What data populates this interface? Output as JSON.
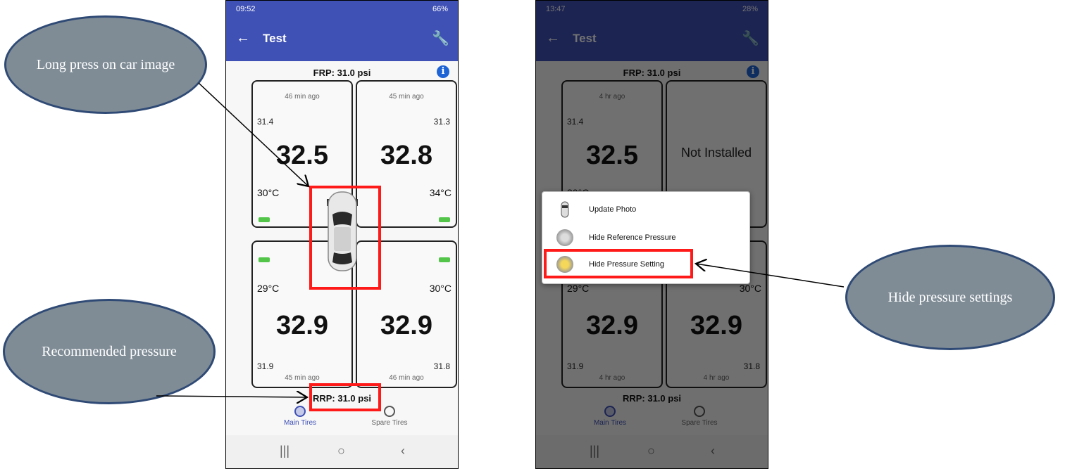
{
  "annotations": {
    "long_press": "Long press on car image",
    "recommended": "Recommended pressure",
    "hide_settings": "Hide pressure settings"
  },
  "phone1": {
    "status_time": "09:52",
    "status_right": "66%",
    "title": "Test",
    "frp": "FRP: 31.0 psi",
    "rrp": "RRP: 31.0 psi",
    "tires": {
      "fl": {
        "ago": "46 min ago",
        "ref": "31.4",
        "pressure": "32.5",
        "temp": "30°C"
      },
      "fr": {
        "ago": "45 min ago",
        "ref": "31.3",
        "pressure": "32.8",
        "temp": "34°C"
      },
      "rl": {
        "ago": "45 min ago",
        "ref": "31.9",
        "pressure": "32.9",
        "temp": "29°C"
      },
      "rr": {
        "ago": "46 min ago",
        "ref": "31.8",
        "pressure": "32.9",
        "temp": "30°C"
      }
    },
    "nav": {
      "main": "Main Tires",
      "spare": "Spare Tires"
    }
  },
  "phone2": {
    "status_time": "13:47",
    "status_right": "28%",
    "title": "Test",
    "frp": "FRP: 31.0 psi",
    "rrp": "RRP: 31.0 psi",
    "tires": {
      "fl": {
        "ago": "4 hr ago",
        "ref": "31.4",
        "pressure": "32.5",
        "temp": "30°C"
      },
      "fr": {
        "not_installed": "Not Installed"
      },
      "rl": {
        "ago": "4 hr ago",
        "ref": "31.9",
        "pressure": "32.9",
        "temp": "29°C"
      },
      "rr": {
        "ago": "4 hr ago",
        "ref": "31.8",
        "pressure": "32.9",
        "temp": "30°C"
      }
    },
    "menu": [
      "Update Photo",
      "Hide Reference Pressure",
      "Hide Pressure Setting"
    ],
    "nav": {
      "main": "Main Tires",
      "spare": "Spare Tires"
    }
  },
  "colors": {
    "appbar": "#3f51b5",
    "battery": "#53c64a",
    "highlight": "#ff1a1a",
    "bubble": "#7f8c96"
  }
}
